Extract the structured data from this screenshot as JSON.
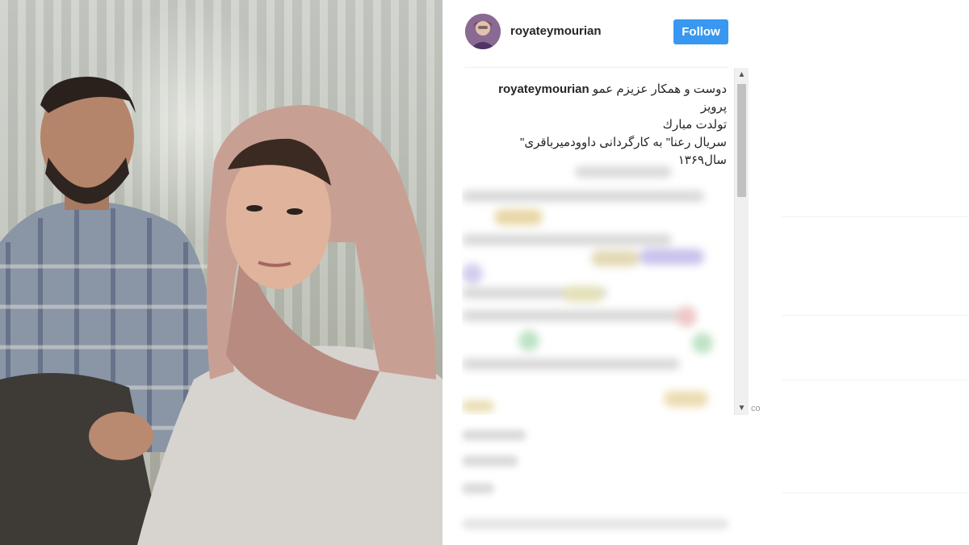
{
  "post": {
    "username": "royateymourian",
    "follow_label": "Follow",
    "caption": {
      "user": "royateymourian",
      "line1": "دوست و همکار عزیزم عمو",
      "line2": "پرویز",
      "line3": "تولدت مبارك",
      "line4": "سریال رعنا\" به کارگردانی داوودمیرباقری\"",
      "line5": "سال۱۳۶۹"
    },
    "clipped_text": "co"
  },
  "colors": {
    "follow_button": "#3897f0",
    "text": "#262626"
  },
  "icons": {
    "scroll_up": "▲",
    "scroll_down": "▼"
  }
}
